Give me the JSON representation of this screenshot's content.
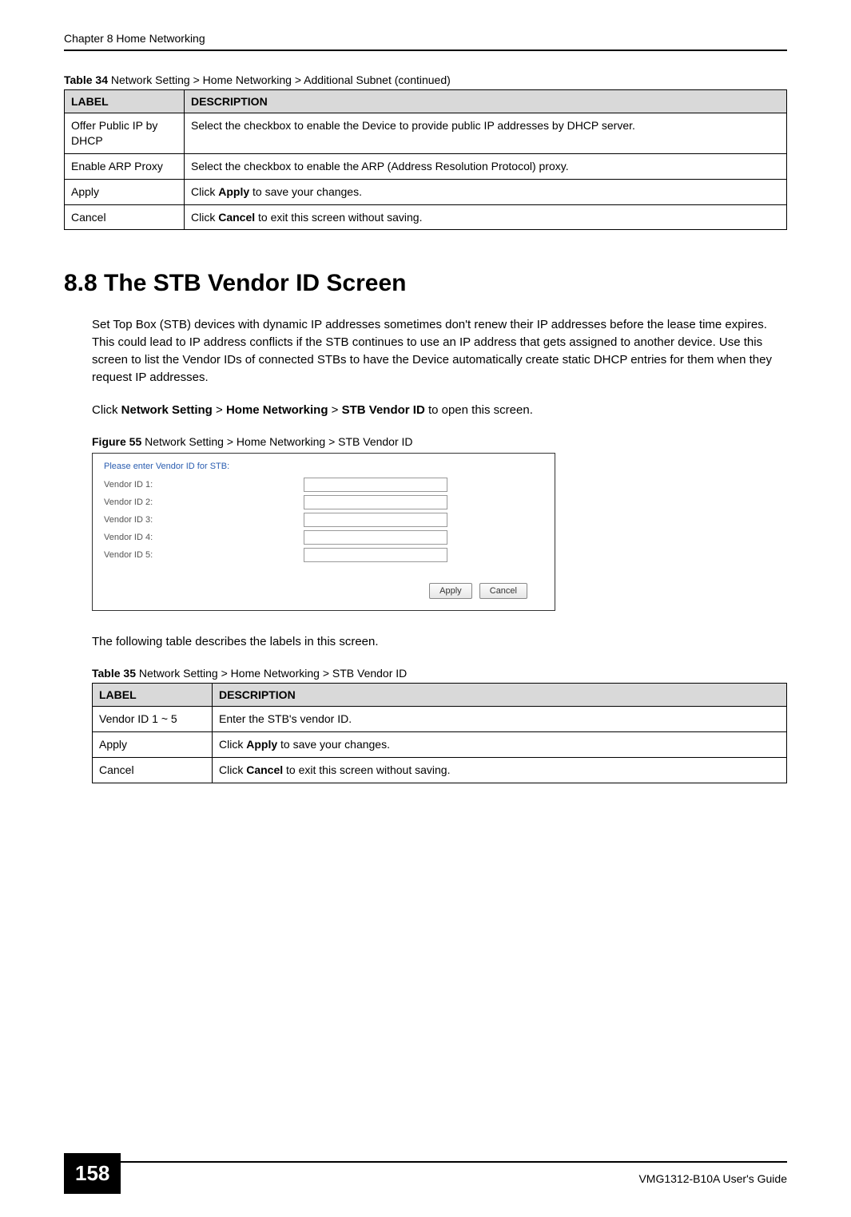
{
  "chapter_header": "Chapter 8 Home Networking",
  "table34": {
    "caption_prefix": "Table 34   ",
    "caption": "Network Setting > Home Networking > Additional Subnet (continued)",
    "header_label": "LABEL",
    "header_desc": "DESCRIPTION",
    "rows": [
      {
        "label": "Offer Public IP by DHCP",
        "desc": "Select the checkbox to enable the Device to provide public IP addresses by DHCP server."
      },
      {
        "label": "Enable ARP Proxy",
        "desc": "Select the checkbox to enable the ARP (Address Resolution Protocol) proxy."
      },
      {
        "label": "Apply",
        "desc_pre": "Click ",
        "desc_bold": "Apply",
        "desc_post": " to save your changes."
      },
      {
        "label": "Cancel",
        "desc_pre": "Click ",
        "desc_bold": "Cancel",
        "desc_post": " to exit this screen without saving."
      }
    ]
  },
  "section_heading": "8.8  The STB Vendor ID Screen",
  "para1": "Set Top Box (STB) devices with dynamic IP addresses sometimes don't renew their IP addresses before the lease time expires. This could lead to IP address conflicts if the STB continues to use an IP address that gets assigned to another device. Use this screen to list the Vendor IDs of connected STBs to have the Device automatically create static DHCP entries for them when they request IP addresses.",
  "para2_pre": "Click ",
  "para2_b1": "Network Setting",
  "para2_s1": " > ",
  "para2_b2": "Home Networking",
  "para2_s2": " > ",
  "para2_b3": "STB Vendor ID",
  "para2_post": " to open this screen.",
  "figure_caption_prefix": "Figure 55   ",
  "figure_caption": "Network Setting > Home Networking > STB Vendor ID",
  "screenshot": {
    "title": "Please enter Vendor ID for STB:",
    "labels": [
      "Vendor ID 1:",
      "Vendor ID 2:",
      "Vendor ID 3:",
      "Vendor ID 4:",
      "Vendor ID 5:"
    ],
    "apply_btn": "Apply",
    "cancel_btn": "Cancel"
  },
  "para3": "The following table describes the labels in this screen.",
  "table35": {
    "caption_prefix": "Table 35   ",
    "caption": "Network Setting > Home Networking > STB Vendor ID",
    "header_label": "LABEL",
    "header_desc": "DESCRIPTION",
    "rows": [
      {
        "label": "Vendor ID 1 ~ 5",
        "desc": "Enter the STB's vendor ID."
      },
      {
        "label": "Apply",
        "desc_pre": "Click ",
        "desc_bold": "Apply",
        "desc_post": " to save your changes."
      },
      {
        "label": "Cancel",
        "desc_pre": "Click ",
        "desc_bold": "Cancel",
        "desc_post": " to exit this screen without saving."
      }
    ]
  },
  "page_number": "158",
  "guide_name": "VMG1312-B10A User's Guide"
}
